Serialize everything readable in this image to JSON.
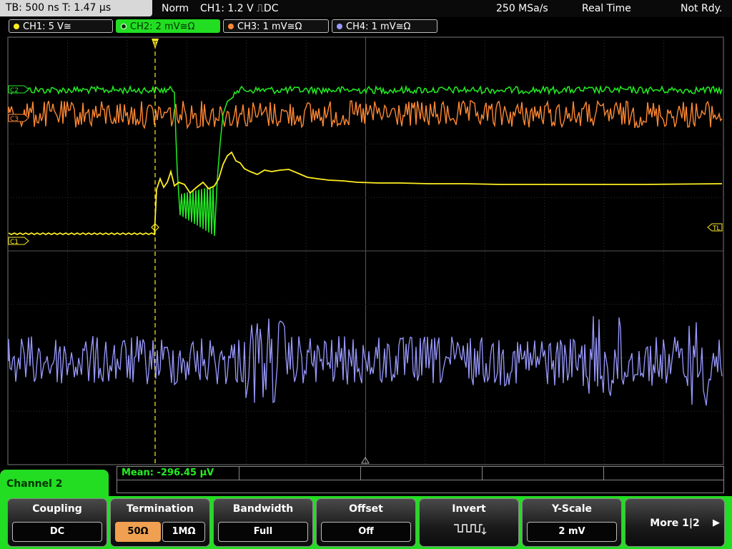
{
  "topbar": {
    "timebase": "TB: 500 ns   T: 1.47 µs",
    "mode": "Norm",
    "trigger": "CH1: 1.2 V ⎍DC",
    "sample_rate": "250 MSa/s",
    "acq_mode": "Real Time",
    "status": "Not Rdy."
  },
  "channels": [
    {
      "label": "CH1: 5 V≅",
      "color": "#ffee22"
    },
    {
      "label": "CH2: 2 mV≅Ω",
      "color": "#22ee22"
    },
    {
      "label": "CH3: 1 mV≅Ω",
      "color": "#ff8833"
    },
    {
      "label": "CH4: 1 mV≅Ω",
      "color": "#9999ff"
    }
  ],
  "markers": {
    "c2": "C2",
    "c3": "C3",
    "c1": "C1",
    "tl": "TL"
  },
  "measurement": {
    "mean": "Mean: -296.45 µV"
  },
  "menu": {
    "title": "Channel 2",
    "coupling": {
      "label": "Coupling",
      "value": "DC"
    },
    "termination": {
      "label": "Termination",
      "opt1": "50Ω",
      "opt2": "1MΩ"
    },
    "bandwidth": {
      "label": "Bandwidth",
      "value": "Full"
    },
    "offset": {
      "label": "Offset",
      "value": "Off"
    },
    "invert": {
      "label": "Invert"
    },
    "yscale": {
      "label": "Y-Scale",
      "value": "2 mV"
    },
    "more": {
      "label": "More 1|2"
    }
  }
}
